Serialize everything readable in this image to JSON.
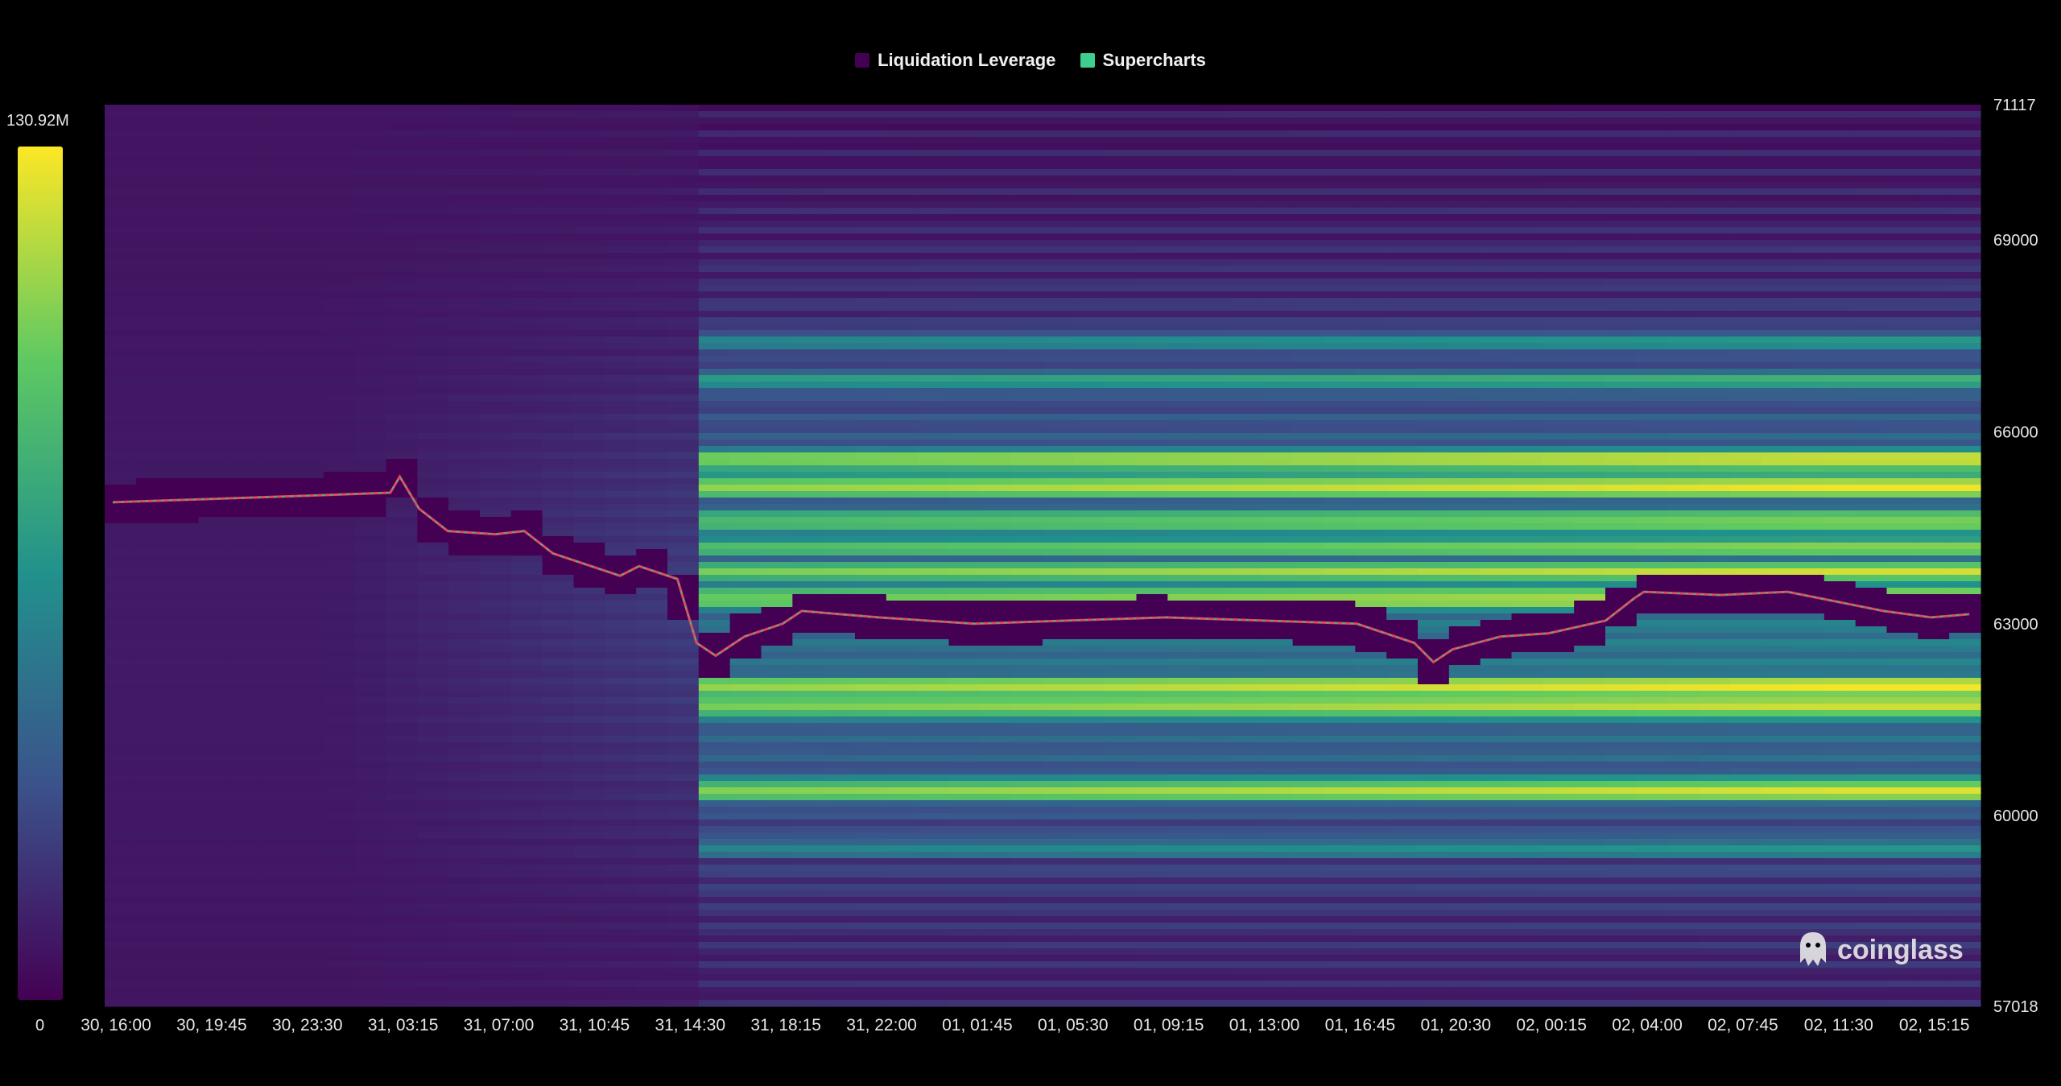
{
  "legend": [
    {
      "label": "Liquidation Leverage",
      "color": "#440154"
    },
    {
      "label": "Supercharts",
      "color": "#3ecf8e"
    }
  ],
  "watermark": "coinglass",
  "chart_data": {
    "type": "heatmap",
    "colorscale": [
      "#440154",
      "#3b528b",
      "#21918c",
      "#5ec962",
      "#fde725"
    ],
    "colorbar": {
      "max_label": "130.92M",
      "min_label": "0"
    },
    "y_ticks": [
      "71117",
      "69000",
      "66000",
      "63000",
      "60000",
      "57018"
    ],
    "y_tick_values": [
      71117,
      69000,
      66000,
      63000,
      60000,
      57018
    ],
    "ylim": [
      57018,
      71117
    ],
    "x_ticks": [
      "30, 16:00",
      "30, 19:45",
      "30, 23:30",
      "31, 03:15",
      "31, 07:00",
      "31, 10:45",
      "31, 14:30",
      "31, 18:15",
      "31, 22:00",
      "01, 01:45",
      "01, 05:30",
      "01, 09:15",
      "01, 13:00",
      "01, 16:45",
      "01, 20:30",
      "02, 00:15",
      "02, 04:00",
      "02, 07:45",
      "02, 11:30",
      "02, 15:15"
    ],
    "bands": [
      {
        "price": 65150,
        "intensity_before": 0.3,
        "intensity_after": 1.0
      },
      {
        "price": 65550,
        "intensity_before": 0.25,
        "intensity_after": 0.95
      },
      {
        "price": 64600,
        "intensity_before": 0.3,
        "intensity_after": 0.85
      },
      {
        "price": 64200,
        "intensity_before": 0.25,
        "intensity_after": 0.8
      },
      {
        "price": 63800,
        "intensity_before": 0.2,
        "intensity_after": 0.9
      },
      {
        "price": 63400,
        "intensity_before": 0.2,
        "intensity_after": 0.95
      },
      {
        "price": 62000,
        "intensity_before": 0.25,
        "intensity_after": 1.0
      },
      {
        "price": 61700,
        "intensity_before": 0.2,
        "intensity_after": 0.95
      },
      {
        "price": 60400,
        "intensity_before": 0.15,
        "intensity_after": 0.95
      },
      {
        "price": 66800,
        "intensity_before": 0.2,
        "intensity_after": 0.6
      },
      {
        "price": 67400,
        "intensity_before": 0.15,
        "intensity_after": 0.5
      },
      {
        "price": 59500,
        "intensity_before": 0.1,
        "intensity_after": 0.5
      }
    ],
    "price_series": {
      "name": "",
      "points": [
        [
          0,
          64900
        ],
        [
          1,
          64950
        ],
        [
          2,
          65000
        ],
        [
          2.9,
          65050
        ],
        [
          3.0,
          65300
        ],
        [
          3.2,
          64800
        ],
        [
          3.5,
          64450
        ],
        [
          4.0,
          64400
        ],
        [
          4.3,
          64450
        ],
        [
          4.6,
          64100
        ],
        [
          5.0,
          63900
        ],
        [
          5.3,
          63750
        ],
        [
          5.5,
          63900
        ],
        [
          5.9,
          63700
        ],
        [
          6.1,
          62700
        ],
        [
          6.3,
          62500
        ],
        [
          6.6,
          62800
        ],
        [
          7.0,
          63000
        ],
        [
          7.2,
          63200
        ],
        [
          8.0,
          63100
        ],
        [
          9.0,
          63000
        ],
        [
          10.0,
          63050
        ],
        [
          11.0,
          63100
        ],
        [
          12.0,
          63050
        ],
        [
          13.0,
          63000
        ],
        [
          13.6,
          62700
        ],
        [
          13.8,
          62400
        ],
        [
          14.0,
          62600
        ],
        [
          14.5,
          62800
        ],
        [
          15.0,
          62850
        ],
        [
          15.6,
          63050
        ],
        [
          15.9,
          63400
        ],
        [
          16.0,
          63500
        ],
        [
          16.8,
          63450
        ],
        [
          17.5,
          63500
        ],
        [
          18.0,
          63350
        ],
        [
          18.5,
          63200
        ],
        [
          19.0,
          63100
        ],
        [
          19.4,
          63150
        ]
      ]
    }
  }
}
